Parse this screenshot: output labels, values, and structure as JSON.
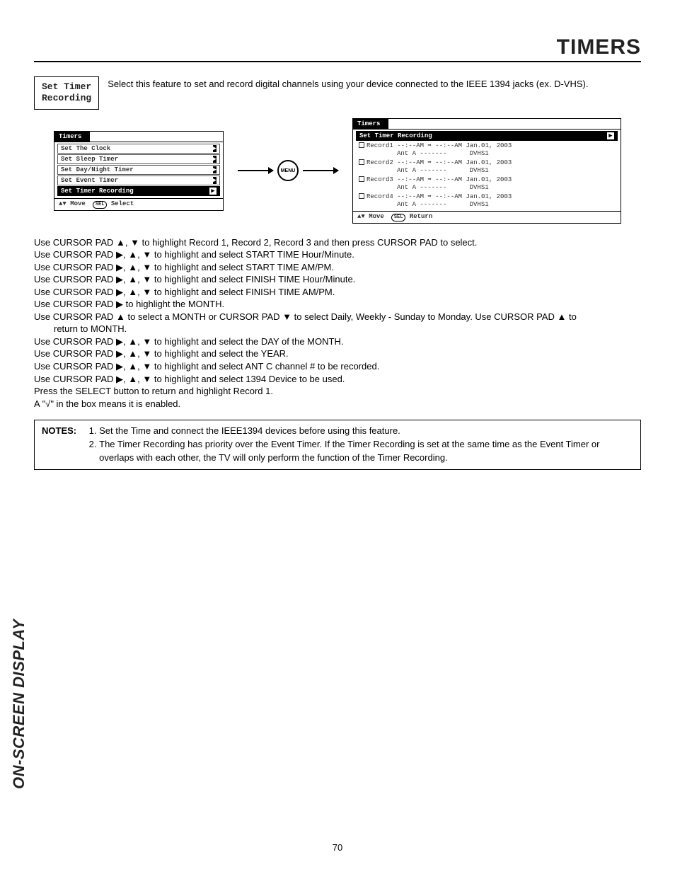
{
  "header": {
    "title": "TIMERS"
  },
  "sideLabel": "ON-SCREEN DISPLAY",
  "pageNumber": "70",
  "setBox": {
    "line1": "Set Timer",
    "line2": "Recording"
  },
  "introText": "Select this feature to set and record digital channels using your device connected to the IEEE 1394 jacks (ex. D-VHS).",
  "menuBtn": "MENU",
  "leftMenu": {
    "title": "Timers",
    "items": [
      "Set The Clock",
      "Set Sleep Timer",
      "Set Day/Night Timer",
      "Set Event Timer",
      "Set Timer Recording"
    ],
    "footerMove": "Move",
    "footerSel": "SEL",
    "footerSelect": "Select"
  },
  "rightMenu": {
    "title": "Timers",
    "sub": "Set Timer Recording",
    "records": [
      {
        "line1": "Record1 --:--AM ➡ --:--AM Jan.01, 2003",
        "line2": "          Ant A -------      DVHS1"
      },
      {
        "line1": "Record2 --:--AM ➡ --:--AM Jan.01, 2003",
        "line2": "          Ant A -------      DVHS1"
      },
      {
        "line1": "Record3 --:--AM ➡ --:--AM Jan.01, 2003",
        "line2": "          Ant A -------      DVHS1"
      },
      {
        "line1": "Record4 --:--AM ➡ --:--AM Jan.01, 2003",
        "line2": "          Ant A -------      DVHS1"
      }
    ],
    "footerMove": "Move",
    "footerSel": "SEL",
    "footerReturn": "Return"
  },
  "instructions": [
    "Use CURSOR PAD ▲, ▼ to highlight Record 1, Record 2, Record 3 and then press CURSOR PAD to select.",
    "Use CURSOR PAD ▶, ▲, ▼ to highlight and select START TIME Hour/Minute.",
    "Use CURSOR PAD ▶, ▲, ▼ to highlight and select START TIME AM/PM.",
    "Use CURSOR PAD ▶, ▲, ▼ to highlight and select FINISH TIME Hour/Minute.",
    "Use CURSOR PAD ▶, ▲, ▼ to highlight and select FINISH TIME AM/PM.",
    "Use CURSOR PAD ▶ to highlight the MONTH.",
    "Use CURSOR PAD ▲ to select a MONTH or CURSOR PAD ▼ to select Daily, Weekly - Sunday to Monday.  Use CURSOR PAD ▲ to",
    "return to MONTH.",
    "Use CURSOR PAD ▶, ▲, ▼ to highlight and select the DAY of the MONTH.",
    "Use CURSOR PAD ▶, ▲, ▼ to highlight and select the YEAR.",
    "Use CURSOR PAD ▶, ▲, ▼ to highlight and select ANT C channel # to be recorded.",
    "Use CURSOR PAD ▶, ▲, ▼ to highlight and select 1394 Device to be used.",
    "Press the SELECT button to return and highlight Record 1.",
    "A \"√\" in the box means it is enabled."
  ],
  "notes": {
    "label": "NOTES:",
    "items": [
      "Set the Time and connect the IEEE1394 devices before using this feature.",
      "The Timer Recording has priority over the Event Timer.  If the Timer Recording is set at the same time as the Event Timer or overlaps with each other, the TV will only perform the function of the Timer Recording."
    ]
  }
}
